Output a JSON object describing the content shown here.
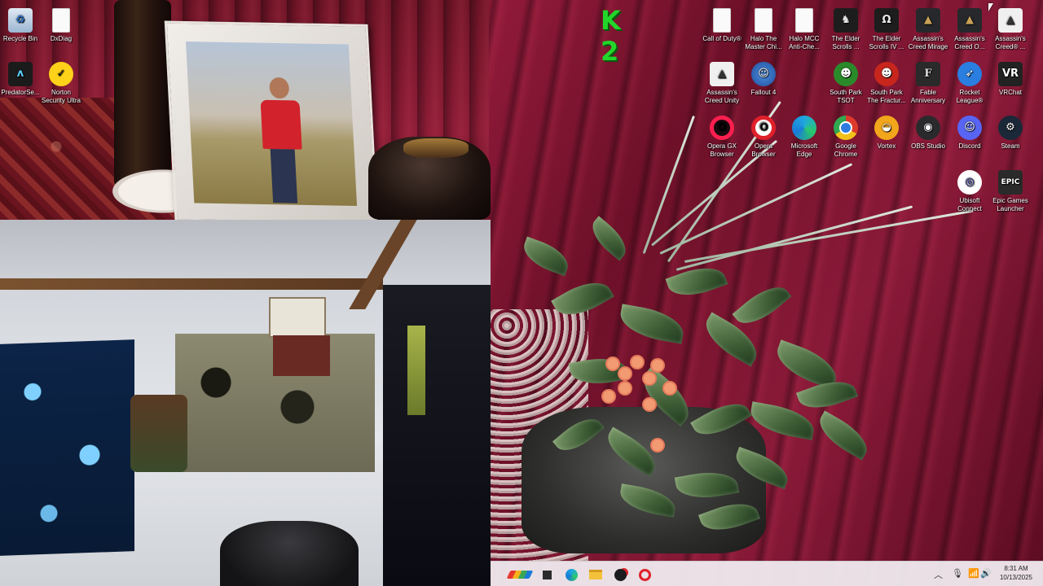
{
  "desktop": {
    "icons": [
      {
        "label": "Recycle Bin",
        "icon": "recycle-bin-icon",
        "glyph": "♻"
      },
      {
        "label": "DxDiag",
        "icon": "document-icon",
        "glyph": ""
      },
      {
        "label": "PredatorSe...",
        "icon": "predator-sense-icon",
        "glyph": "ᴧ"
      },
      {
        "label": "Norton Security Ultra",
        "icon": "norton-icon",
        "glyph": "✓"
      },
      {
        "label": "Call of Duty®",
        "icon": "document-icon",
        "glyph": ""
      },
      {
        "label": "Halo The Master Chi...",
        "icon": "document-icon",
        "glyph": ""
      },
      {
        "label": "Halo MCC Anti-Che...",
        "icon": "document-icon",
        "glyph": ""
      },
      {
        "label": "The Elder Scrolls ...",
        "icon": "elder-scrolls-dragon-icon",
        "glyph": "♞"
      },
      {
        "label": "The Elder Scrolls IV ...",
        "icon": "elder-scrolls-oblivion-icon",
        "glyph": "Ω"
      },
      {
        "label": "Assassin's Creed Mirage",
        "icon": "assassins-creed-mirage-icon",
        "glyph": "▲"
      },
      {
        "label": "Assassin's Creed O...",
        "icon": "assassins-creed-odyssey-icon",
        "glyph": "▲"
      },
      {
        "label": "Assassin's Creed® ...",
        "icon": "assassins-creed-icon",
        "glyph": "▲"
      },
      {
        "label": "Assassin's Creed Unity",
        "icon": "assassins-creed-unity-icon",
        "glyph": "▲"
      },
      {
        "label": "Fallout 4",
        "icon": "fallout-vault-boy-icon",
        "glyph": "☺"
      },
      {
        "label": "South Park TSOT",
        "icon": "south-park-tsot-icon",
        "glyph": "☻"
      },
      {
        "label": "South Park The Fractur...",
        "icon": "south-park-fractured-icon",
        "glyph": "☻"
      },
      {
        "label": "Fable Anniversary",
        "icon": "fable-icon",
        "glyph": "F"
      },
      {
        "label": "Rocket League®",
        "icon": "rocket-league-icon",
        "glyph": "➶"
      },
      {
        "label": "VRChat",
        "icon": "vrchat-icon",
        "glyph": "VR"
      },
      {
        "label": "Opera GX Browser",
        "icon": "opera-gx-icon",
        "glyph": "O"
      },
      {
        "label": "Opera Browser",
        "icon": "opera-icon",
        "glyph": "O"
      },
      {
        "label": "Microsoft Edge",
        "icon": "edge-icon",
        "glyph": ""
      },
      {
        "label": "Google Chrome",
        "icon": "chrome-icon",
        "glyph": ""
      },
      {
        "label": "Vortex",
        "icon": "vortex-icon",
        "glyph": "◒"
      },
      {
        "label": "OBS Studio",
        "icon": "obs-icon",
        "glyph": "◉"
      },
      {
        "label": "Discord",
        "icon": "discord-icon",
        "glyph": "☺"
      },
      {
        "label": "Steam",
        "icon": "steam-icon",
        "glyph": "⚙"
      },
      {
        "label": "Ubisoft Connect",
        "icon": "ubisoft-icon",
        "glyph": "◎"
      },
      {
        "label": "Epic Games Launcher",
        "icon": "epic-games-icon",
        "glyph": "EPIC"
      }
    ],
    "overlay_logo_text": "K 2"
  },
  "taskbar": {
    "apps": [
      {
        "name": "start",
        "icon": "windows-start-icon"
      },
      {
        "name": "task-view",
        "icon": "task-view-icon"
      },
      {
        "name": "edge",
        "icon": "edge-icon"
      },
      {
        "name": "file-explorer",
        "icon": "folder-icon"
      },
      {
        "name": "obs",
        "icon": "obs-icon"
      },
      {
        "name": "opera",
        "icon": "opera-icon"
      }
    ],
    "tray": {
      "chevron": "︿",
      "mic": "🎙",
      "wifi": "📶",
      "volume": "🔊"
    },
    "clock": {
      "time": "8:31 AM",
      "date": "10/13/2025"
    }
  },
  "colors": {
    "wallpaper": "#8a1a38",
    "taskbar": "#eee8ec",
    "overlay_green": "#22d62a"
  }
}
